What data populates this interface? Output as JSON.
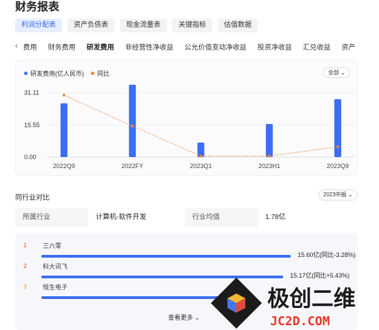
{
  "page_title": "财务报表",
  "report_tabs": [
    "利润分配表",
    "资产负债表",
    "现金流量表",
    "关键指标",
    "估值数据"
  ],
  "sub_tabs": [
    "费用",
    "财务费用",
    "研发费用",
    "非经营性净收益",
    "公允价值变动净收益",
    "投资净收益",
    "汇兑收益",
    "资产"
  ],
  "active_sub_tab": 2,
  "chart": {
    "legend_bar": "研发费用(亿人民币)",
    "legend_line": "同比",
    "range_label": "全部",
    "y_ticks": [
      "31.11",
      "15.55",
      "0.00"
    ]
  },
  "chart_data": {
    "type": "bar",
    "categories": [
      "2022Q9",
      "",
      "2022FY",
      "",
      "2023Q1",
      "",
      "2023H1",
      "",
      "2023Q9"
    ],
    "series": [
      {
        "name": "研发费用(亿人民币)",
        "values": [
          26,
          null,
          35,
          null,
          7,
          null,
          16,
          null,
          28
        ]
      },
      {
        "name": "同比",
        "type": "line",
        "values": [
          30,
          null,
          15,
          null,
          0.5,
          null,
          0.5,
          null,
          5
        ]
      }
    ],
    "ylim": [
      0,
      36
    ],
    "y_ticks": [
      0.0,
      15.55,
      31.11
    ]
  },
  "peer": {
    "section_title": "同行业对比",
    "period_label": "2023中报",
    "industry_label": "所属行业",
    "industry_value": "计算机-软件开发",
    "avg_label": "行业均值",
    "avg_value": "1.78亿"
  },
  "ranking": [
    {
      "rank": "1",
      "name": "三六零",
      "value_text": "15.60亿(同比-3.28%)",
      "fraction": 1.0
    },
    {
      "rank": "2",
      "name": "科大讯飞",
      "value_text": "15.17亿(同比+5.43%)",
      "fraction": 0.97
    },
    {
      "rank": "3",
      "name": "恒生电子",
      "value_text": "",
      "fraction": 0.73
    }
  ],
  "see_more": "查看更多",
  "colors": {
    "accent": "#3b63e8",
    "bar": "#3b6ef0",
    "line": "#f0883a",
    "rank_top": "#e8553e",
    "rank_third": "#f0a53a"
  },
  "watermark": {
    "main": "极创二维",
    "sub": "JC2D.COM"
  }
}
